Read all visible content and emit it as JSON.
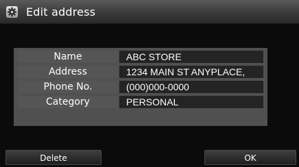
{
  "header": {
    "title": "Edit address",
    "icon": "gear-icon"
  },
  "fields": [
    {
      "label": "Name",
      "value": "ABC STORE"
    },
    {
      "label": "Address",
      "value": "1234 MAIN ST ANYPLACE,"
    },
    {
      "label": "Phone No.",
      "value": "(000)000-0000"
    },
    {
      "label": "Category",
      "value": "PERSONAL"
    }
  ],
  "buttons": {
    "delete_label": "Delete",
    "ok_label": "OK"
  }
}
